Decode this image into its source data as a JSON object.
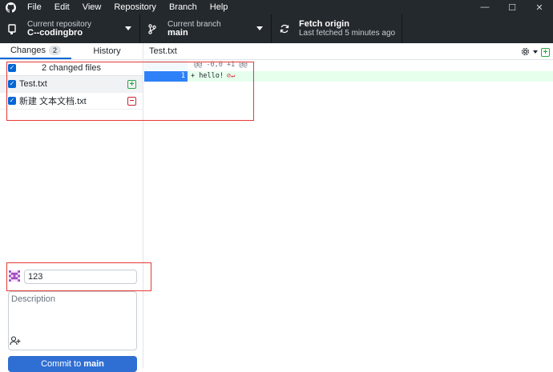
{
  "menu": [
    "File",
    "Edit",
    "View",
    "Repository",
    "Branch",
    "Help"
  ],
  "window_controls": {
    "minimize": "—",
    "maximize": "☐",
    "close": "✕"
  },
  "toolbar": {
    "repo": {
      "label": "Current repository",
      "value": "C--codingbro"
    },
    "branch": {
      "label": "Current branch",
      "value": "main"
    },
    "fetch": {
      "label": "Fetch origin",
      "value": "Last fetched 5 minutes ago"
    }
  },
  "sidebar": {
    "tabs": {
      "changes": "Changes",
      "changes_count": "2",
      "history": "History"
    },
    "files_header": "2 changed files",
    "files": [
      {
        "name": "Test.txt",
        "status": "+"
      },
      {
        "name": "新建 文本文档.txt",
        "status": "−"
      }
    ]
  },
  "commit": {
    "summary": "123",
    "description_placeholder": "Description",
    "button_prefix": "Commit to",
    "button_branch": "main"
  },
  "diff": {
    "file": "Test.txt",
    "hunk": "@@ -0,0 +1 @@",
    "line_new": "1",
    "line_text": "+  hello!",
    "no_newline": "⊘↵"
  },
  "colors": {
    "accent": "#0366d6",
    "dark": "#24292e",
    "highlight": "#e53935",
    "added": "#28a745",
    "removed": "#cb2431"
  }
}
